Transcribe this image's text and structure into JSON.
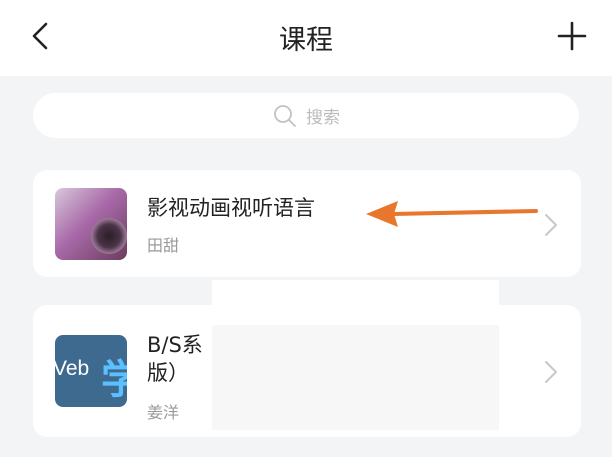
{
  "header": {
    "title": "课程",
    "back_icon": "chevron-left-icon",
    "add_icon": "plus-icon"
  },
  "search": {
    "placeholder": "搜索",
    "icon": "search-icon"
  },
  "courses": [
    {
      "title": "影视动画视听语言",
      "teacher": "田甜",
      "thumbnail": "camera-lens-image"
    },
    {
      "title": "B/S系\n版）",
      "teacher": "姜洋",
      "thumbnail": "web-xue-logo",
      "logo_text": "Veb",
      "logo_glyph": "学"
    }
  ],
  "annotation": {
    "arrow_color": "#e8762c",
    "icon": "annotation-arrow-icon"
  },
  "colors": {
    "background": "#f3f4f6",
    "card": "#ffffff",
    "secondary_text": "#9a9a9a"
  }
}
